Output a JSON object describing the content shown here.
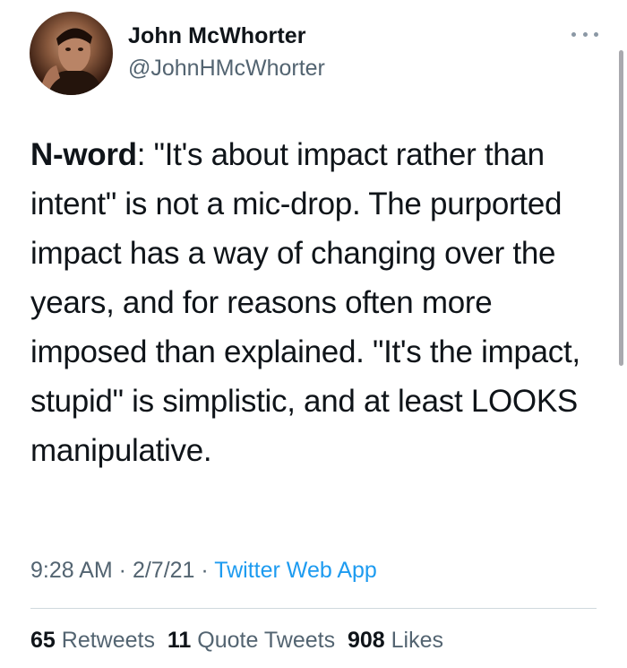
{
  "author": {
    "name": "John McWhorter",
    "handle": "@JohnHMcWhorter"
  },
  "tweet": {
    "lead": "N-word",
    "body": ": \"It's about impact rather than intent\" is not a mic-drop. The purported impact has a way of changing over the years, and for reasons often more imposed than explained. \"It's the impact, stupid\" is simplistic, and at least LOOKS manipulative."
  },
  "meta": {
    "time": "9:28 AM",
    "sep1": " · ",
    "date": "2/7/21",
    "sep2": " · ",
    "source": "Twitter Web App"
  },
  "stats": {
    "retweets_count": "65",
    "retweets_label": "Retweets",
    "quotes_count": "11",
    "quotes_label": "Quote Tweets",
    "likes_count": "908",
    "likes_label": "Likes"
  },
  "icons": {
    "more": "more-horizontal-icon"
  },
  "colors": {
    "text": "#0f1419",
    "secondary": "#536471",
    "link": "#1d9bf0",
    "divider": "#cfd9de"
  }
}
